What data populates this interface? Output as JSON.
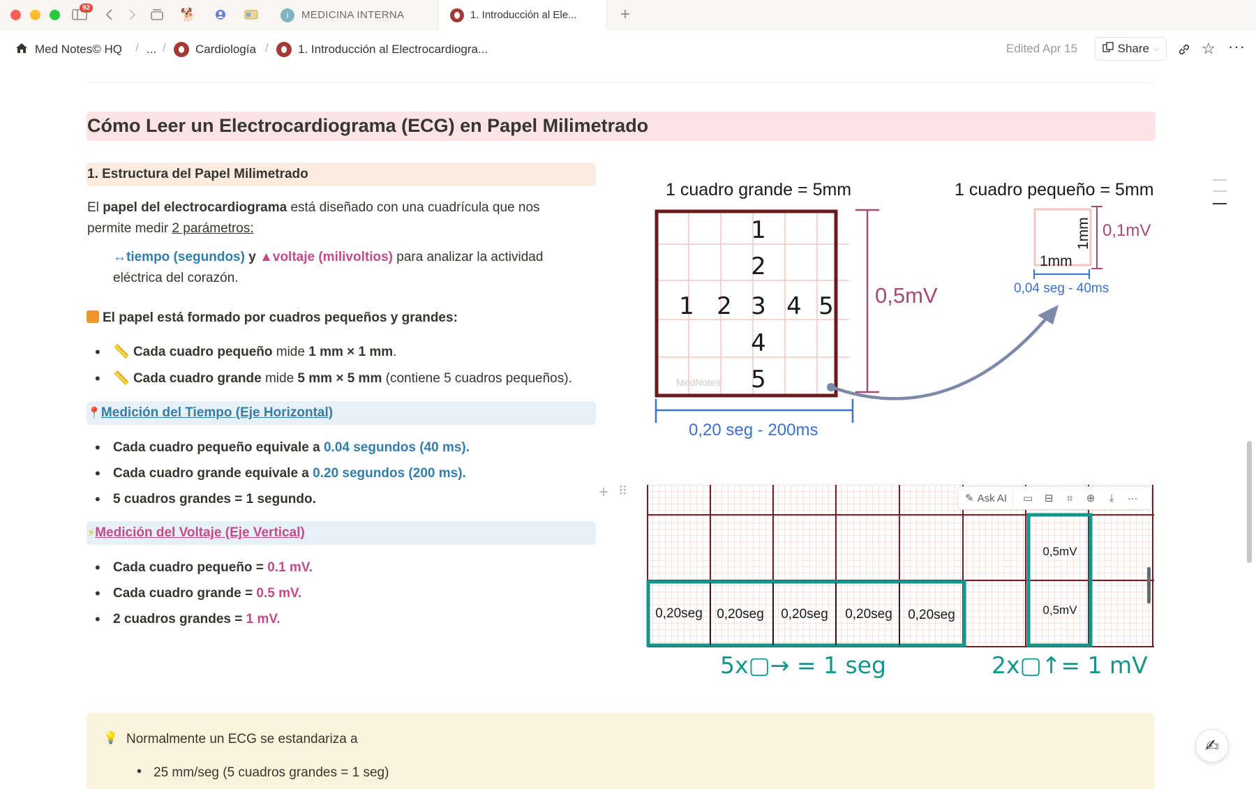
{
  "window": {
    "badge_count": "92",
    "tabs": [
      {
        "label": "MEDICINA INTERNA"
      },
      {
        "label": "1. Introducción al Ele..."
      }
    ]
  },
  "breadcrumb": {
    "workspace": "Med Notes© HQ",
    "ellipsis": "...",
    "cardiologia": "Cardiología",
    "page": "1. Introducción al Electrocardiogra...",
    "edited": "Edited Apr 15",
    "share_label": "Share"
  },
  "content": {
    "main_heading": "Cómo Leer un Electrocardiograma (ECG) en Papel Milimetrado",
    "section1_heading": "1. Estructura del Papel Milimetrado",
    "intro_p1_a": "El ",
    "intro_p1_bold": "papel del electrocardiograma",
    "intro_p1_b": " está diseñado con una cuadrícula que nos",
    "intro_p2_a": "permite medir ",
    "intro_p2_u": " 2 parámetros:",
    "params_time": "↔tiempo (segundos)",
    "params_y": " y ",
    "params_volt": "▲voltaje (milivoltios)",
    "params_rest": " para analizar la actividad",
    "params_line2": "eléctrica del corazón.",
    "paper_heading": "El papel está formado por cuadros pequeños y grandes:",
    "bullet_small_bold": "Cada cuadro pequeño",
    "bullet_small_mid": " mide ",
    "bullet_small_val": "1 mm × 1 mm",
    "bullet_small_end": ".",
    "bullet_large_bold": "Cada cuadro grande",
    "bullet_large_mid": " mide ",
    "bullet_large_val": "5 mm × 5 mm",
    "bullet_large_end": " (contiene 5 cuadros pequeños).",
    "time_heading": "Medición del Tiempo (Eje Horizontal)",
    "time_b1_a": "Cada cuadro pequeño equivale a ",
    "time_b1_v": "0.04 segundos (40 ms).",
    "time_b2_a": "Cada cuadro grande equivale a ",
    "time_b2_v": "0.20 segundos (200 ms).",
    "time_b3": "5 cuadros grandes = 1 segundo.",
    "volt_heading": "Medición del Voltaje (Eje Vertical)",
    "volt_b1_a": "Cada cuadro pequeño = ",
    "volt_b1_v": "0.1 mV.",
    "volt_b2_a": "Cada cuadro grande = ",
    "volt_b2_v": "0.5 mV.",
    "volt_b3_a": "2 cuadros grandes = ",
    "volt_b3_v": "1 mV.",
    "callout_line1": "Normalmente un ECG se estandariza a",
    "callout_bullet1": "25 mm/seg (5 cuadros grandes = 1 seg)"
  },
  "diagram_top": {
    "big_title": "1 cuadro grande = 5mm",
    "small_title": "1 cuadro pequeño = 5mm",
    "col_numbers": [
      "1",
      "2",
      "3",
      "4",
      "5"
    ],
    "row_numbers": [
      "1",
      "2",
      "3",
      "4",
      "5"
    ],
    "big_mv": "0,5mV",
    "big_time": "0,20 seg - 200ms",
    "watermark": "MedNotes",
    "small_mm_v": "1mm",
    "small_mm_h": "1mm",
    "small_mv": "0,1mV",
    "small_time": "0,04 seg - 40ms"
  },
  "diagram_bottom": {
    "seg_labels": [
      "0,20seg",
      "0,20seg",
      "0,20seg",
      "0,20seg",
      "0,20seg"
    ],
    "mv_labels": [
      "0,5mV",
      "0,5mV"
    ],
    "time_formula": "5x▢→ = 1 seg",
    "volt_formula": "2x▢↑= 1 mV"
  },
  "image_toolbar": {
    "ask_ai": "Ask AI"
  },
  "colors": {
    "dark_red": "#6b1b1b",
    "grid_pink": "#f4c6c3",
    "teal": "#14968d",
    "blue_label": "#3b6fd0",
    "mv_pink": "#a44a74",
    "arrow_gray": "#7d89a8"
  }
}
